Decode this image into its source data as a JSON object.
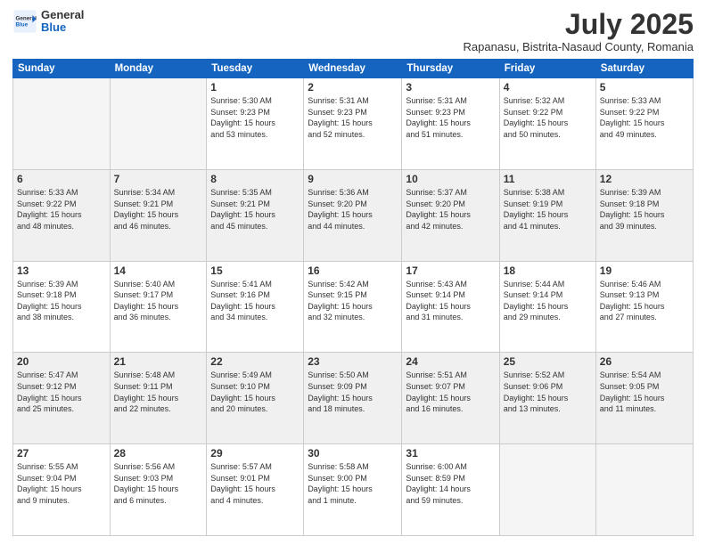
{
  "header": {
    "logo_general": "General",
    "logo_blue": "Blue",
    "month_title": "July 2025",
    "subtitle": "Rapanasu, Bistrita-Nasaud County, Romania"
  },
  "weekdays": [
    "Sunday",
    "Monday",
    "Tuesday",
    "Wednesday",
    "Thursday",
    "Friday",
    "Saturday"
  ],
  "weeks": [
    [
      {
        "day": "",
        "info": ""
      },
      {
        "day": "",
        "info": ""
      },
      {
        "day": "1",
        "info": "Sunrise: 5:30 AM\nSunset: 9:23 PM\nDaylight: 15 hours\nand 53 minutes."
      },
      {
        "day": "2",
        "info": "Sunrise: 5:31 AM\nSunset: 9:23 PM\nDaylight: 15 hours\nand 52 minutes."
      },
      {
        "day": "3",
        "info": "Sunrise: 5:31 AM\nSunset: 9:23 PM\nDaylight: 15 hours\nand 51 minutes."
      },
      {
        "day": "4",
        "info": "Sunrise: 5:32 AM\nSunset: 9:22 PM\nDaylight: 15 hours\nand 50 minutes."
      },
      {
        "day": "5",
        "info": "Sunrise: 5:33 AM\nSunset: 9:22 PM\nDaylight: 15 hours\nand 49 minutes."
      }
    ],
    [
      {
        "day": "6",
        "info": "Sunrise: 5:33 AM\nSunset: 9:22 PM\nDaylight: 15 hours\nand 48 minutes."
      },
      {
        "day": "7",
        "info": "Sunrise: 5:34 AM\nSunset: 9:21 PM\nDaylight: 15 hours\nand 46 minutes."
      },
      {
        "day": "8",
        "info": "Sunrise: 5:35 AM\nSunset: 9:21 PM\nDaylight: 15 hours\nand 45 minutes."
      },
      {
        "day": "9",
        "info": "Sunrise: 5:36 AM\nSunset: 9:20 PM\nDaylight: 15 hours\nand 44 minutes."
      },
      {
        "day": "10",
        "info": "Sunrise: 5:37 AM\nSunset: 9:20 PM\nDaylight: 15 hours\nand 42 minutes."
      },
      {
        "day": "11",
        "info": "Sunrise: 5:38 AM\nSunset: 9:19 PM\nDaylight: 15 hours\nand 41 minutes."
      },
      {
        "day": "12",
        "info": "Sunrise: 5:39 AM\nSunset: 9:18 PM\nDaylight: 15 hours\nand 39 minutes."
      }
    ],
    [
      {
        "day": "13",
        "info": "Sunrise: 5:39 AM\nSunset: 9:18 PM\nDaylight: 15 hours\nand 38 minutes."
      },
      {
        "day": "14",
        "info": "Sunrise: 5:40 AM\nSunset: 9:17 PM\nDaylight: 15 hours\nand 36 minutes."
      },
      {
        "day": "15",
        "info": "Sunrise: 5:41 AM\nSunset: 9:16 PM\nDaylight: 15 hours\nand 34 minutes."
      },
      {
        "day": "16",
        "info": "Sunrise: 5:42 AM\nSunset: 9:15 PM\nDaylight: 15 hours\nand 32 minutes."
      },
      {
        "day": "17",
        "info": "Sunrise: 5:43 AM\nSunset: 9:14 PM\nDaylight: 15 hours\nand 31 minutes."
      },
      {
        "day": "18",
        "info": "Sunrise: 5:44 AM\nSunset: 9:14 PM\nDaylight: 15 hours\nand 29 minutes."
      },
      {
        "day": "19",
        "info": "Sunrise: 5:46 AM\nSunset: 9:13 PM\nDaylight: 15 hours\nand 27 minutes."
      }
    ],
    [
      {
        "day": "20",
        "info": "Sunrise: 5:47 AM\nSunset: 9:12 PM\nDaylight: 15 hours\nand 25 minutes."
      },
      {
        "day": "21",
        "info": "Sunrise: 5:48 AM\nSunset: 9:11 PM\nDaylight: 15 hours\nand 22 minutes."
      },
      {
        "day": "22",
        "info": "Sunrise: 5:49 AM\nSunset: 9:10 PM\nDaylight: 15 hours\nand 20 minutes."
      },
      {
        "day": "23",
        "info": "Sunrise: 5:50 AM\nSunset: 9:09 PM\nDaylight: 15 hours\nand 18 minutes."
      },
      {
        "day": "24",
        "info": "Sunrise: 5:51 AM\nSunset: 9:07 PM\nDaylight: 15 hours\nand 16 minutes."
      },
      {
        "day": "25",
        "info": "Sunrise: 5:52 AM\nSunset: 9:06 PM\nDaylight: 15 hours\nand 13 minutes."
      },
      {
        "day": "26",
        "info": "Sunrise: 5:54 AM\nSunset: 9:05 PM\nDaylight: 15 hours\nand 11 minutes."
      }
    ],
    [
      {
        "day": "27",
        "info": "Sunrise: 5:55 AM\nSunset: 9:04 PM\nDaylight: 15 hours\nand 9 minutes."
      },
      {
        "day": "28",
        "info": "Sunrise: 5:56 AM\nSunset: 9:03 PM\nDaylight: 15 hours\nand 6 minutes."
      },
      {
        "day": "29",
        "info": "Sunrise: 5:57 AM\nSunset: 9:01 PM\nDaylight: 15 hours\nand 4 minutes."
      },
      {
        "day": "30",
        "info": "Sunrise: 5:58 AM\nSunset: 9:00 PM\nDaylight: 15 hours\nand 1 minute."
      },
      {
        "day": "31",
        "info": "Sunrise: 6:00 AM\nSunset: 8:59 PM\nDaylight: 14 hours\nand 59 minutes."
      },
      {
        "day": "",
        "info": ""
      },
      {
        "day": "",
        "info": ""
      }
    ]
  ]
}
